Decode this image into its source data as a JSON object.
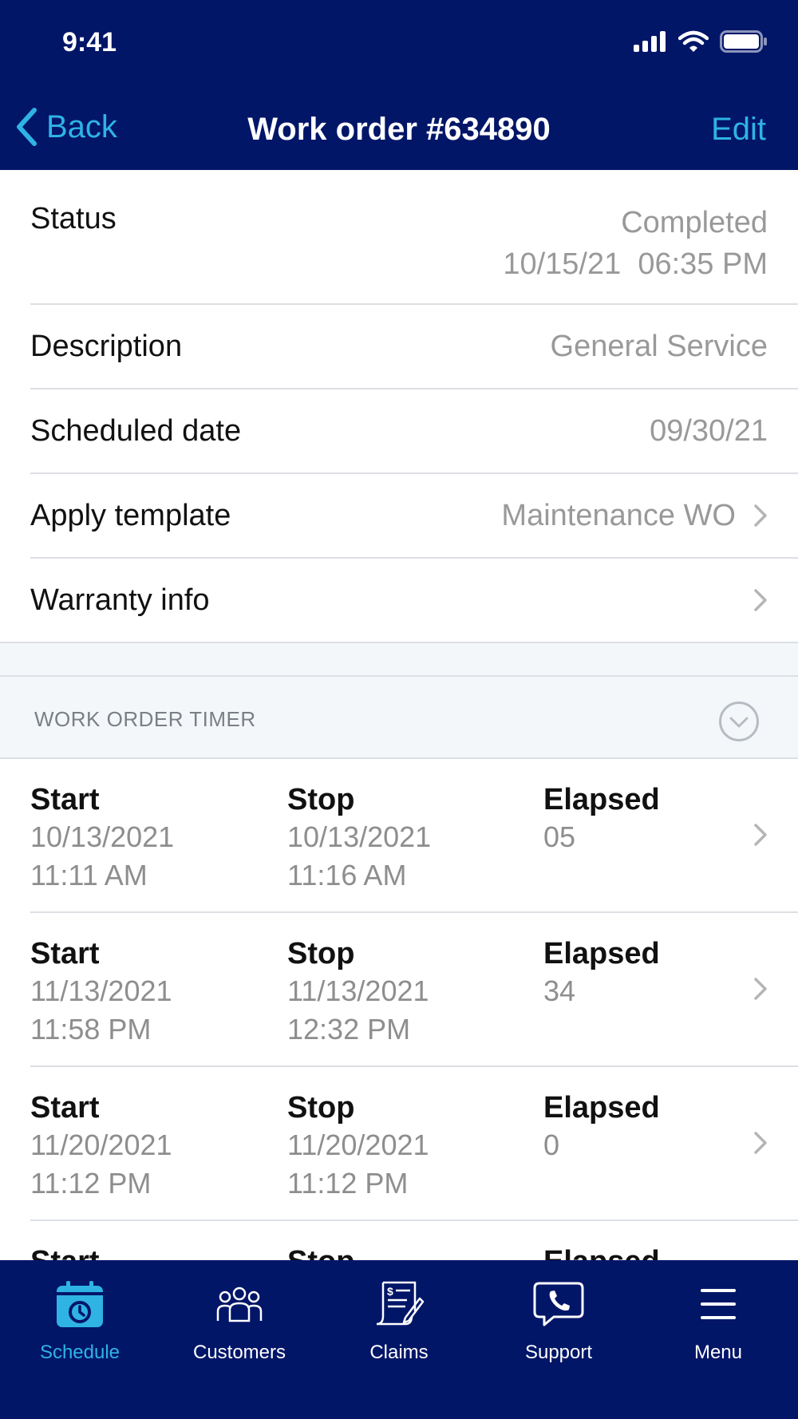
{
  "status_bar": {
    "time": "9:41"
  },
  "nav": {
    "back_label": "Back",
    "title": "Work order #634890",
    "edit_label": "Edit"
  },
  "details": {
    "status": {
      "label": "Status",
      "value": "Completed",
      "datetime": "10/15/21  06:35 PM"
    },
    "description": {
      "label": "Description",
      "value": "General Service"
    },
    "scheduled_date": {
      "label": "Scheduled date",
      "value": "09/30/21"
    },
    "apply_template": {
      "label": "Apply template",
      "value": "Maintenance WO"
    },
    "warranty": {
      "label": "Warranty info"
    }
  },
  "timer_section": {
    "title": "WORK ORDER TIMER",
    "start_label": "Start",
    "stop_label": "Stop",
    "elapsed_label": "Elapsed",
    "entries": [
      {
        "start_date": "10/13/2021",
        "start_time": "11:11 AM",
        "stop_date": "10/13/2021",
        "stop_time": "11:16 AM",
        "elapsed": "05"
      },
      {
        "start_date": "11/13/2021",
        "start_time": "11:58 PM",
        "stop_date": "11/13/2021",
        "stop_time": "12:32 PM",
        "elapsed": "34"
      },
      {
        "start_date": "11/20/2021",
        "start_time": "11:12 PM",
        "stop_date": "11/20/2021",
        "stop_time": "11:12 PM",
        "elapsed": "0"
      },
      {
        "start_date": "",
        "start_time": "",
        "stop_date": "",
        "stop_time": "",
        "elapsed": ""
      }
    ]
  },
  "tabbar": {
    "active": "Schedule",
    "accent_color": "#2fb3e4",
    "background_color": "#021668",
    "items": [
      {
        "label": "Schedule",
        "icon": "calendar-clock-icon"
      },
      {
        "label": "Customers",
        "icon": "people-icon"
      },
      {
        "label": "Claims",
        "icon": "claim-document-icon"
      },
      {
        "label": "Support",
        "icon": "phone-chat-icon"
      },
      {
        "label": "Menu",
        "icon": "hamburger-menu-icon"
      }
    ]
  }
}
